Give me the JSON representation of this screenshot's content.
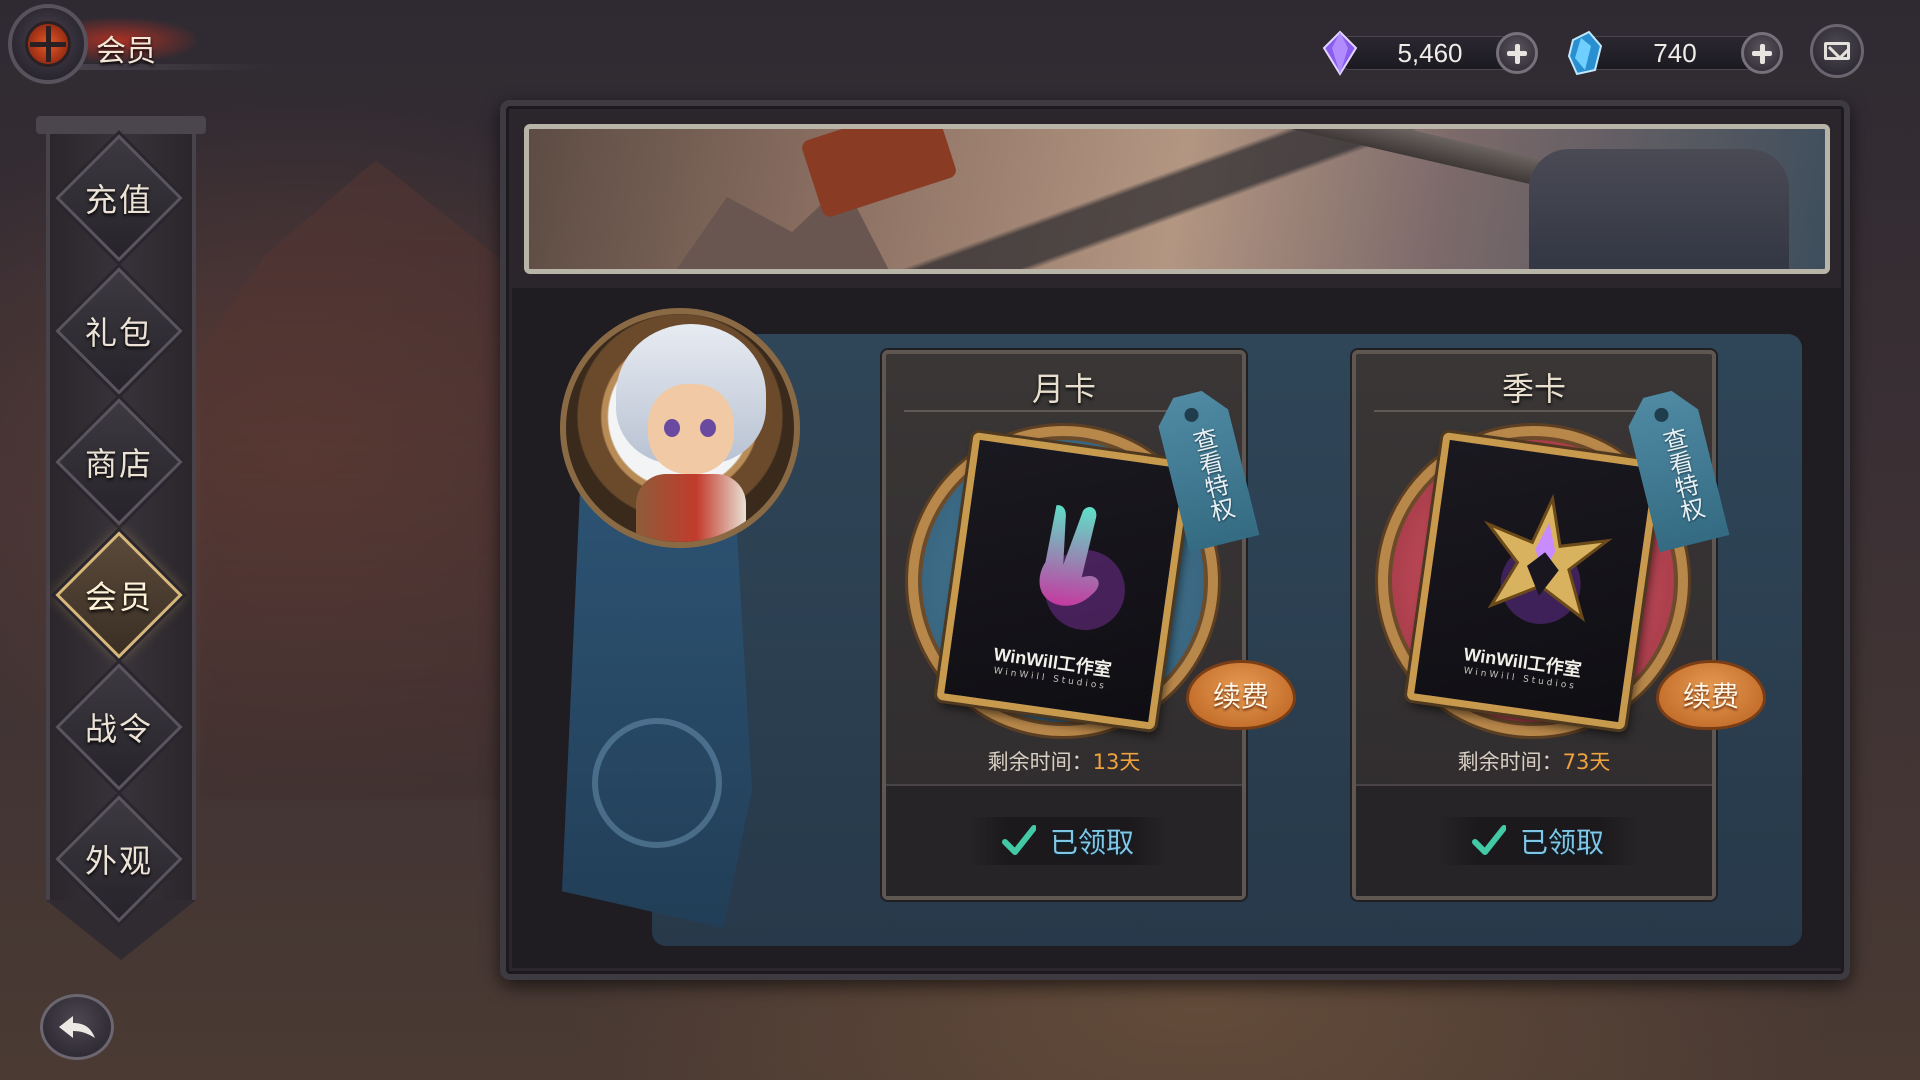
{
  "header": {
    "title": "会员"
  },
  "currencies": [
    {
      "name": "purple-gem",
      "value": "5,460",
      "color": "#8a5cf0"
    },
    {
      "name": "blue-crystal",
      "value": "740",
      "color": "#3aa6e6"
    }
  ],
  "menu": {
    "items": [
      {
        "label": "充值",
        "active": false
      },
      {
        "label": "礼包",
        "active": false
      },
      {
        "label": "商店",
        "active": false
      },
      {
        "label": "会员",
        "active": true
      },
      {
        "label": "战令",
        "active": false
      },
      {
        "label": "外观",
        "active": false
      }
    ]
  },
  "cards": {
    "month": {
      "title": "月卡",
      "tag": "查看特权",
      "studio": "WinWill工作室",
      "studio_sub": "WinWill Studios",
      "renew": "续费",
      "remain_label": "剩余时间：",
      "remain_days": "13天",
      "claim": "已领取",
      "ring_color": "#3e6d88"
    },
    "season": {
      "title": "季卡",
      "tag": "查看特权",
      "studio": "WinWill工作室",
      "studio_sub": "WinWill Studios",
      "renew": "续费",
      "remain_label": "剩余时间：",
      "remain_days": "73天",
      "claim": "已领取",
      "ring_color": "#b84654"
    }
  },
  "colors": {
    "accent_gold": "#c89a4d",
    "claim_blue": "#7fc7e6",
    "days_orange": "#f0a23c"
  }
}
